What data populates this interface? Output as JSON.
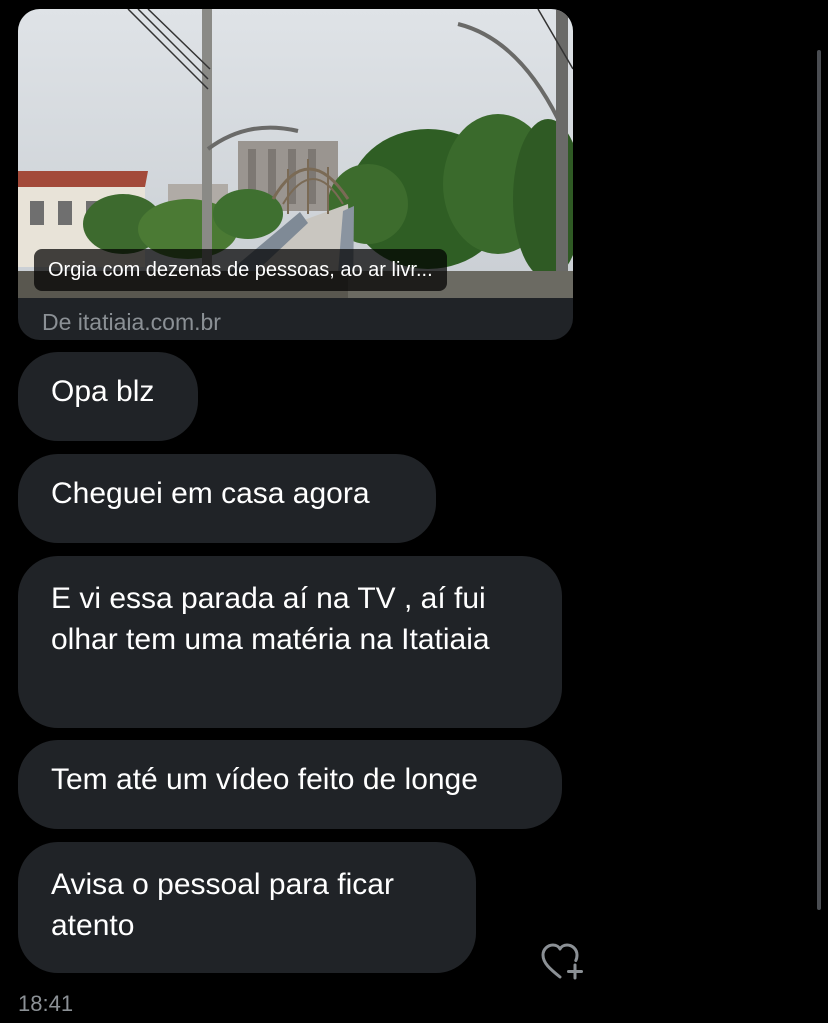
{
  "link_preview": {
    "caption": "Orgia com dezenas de pessoas, ao ar livr...",
    "source": "De itatiaia.com.br",
    "image_icon": "photo-footbridge-city"
  },
  "messages": [
    {
      "text": "Opa blz"
    },
    {
      "text": "Cheguei em casa agora"
    },
    {
      "text": "E vi essa parada aí na TV , aí fui olhar tem uma matéria na Itatiaia"
    },
    {
      "text": "Tem até um vídeo feito de longe"
    },
    {
      "text": "Avisa o pessoal para ficar atento"
    }
  ],
  "reaction_icon": "heart-plus-icon",
  "timestamp": "18:41",
  "colors": {
    "background": "#000000",
    "bubble": "#202327",
    "muted": "#8b9095"
  }
}
